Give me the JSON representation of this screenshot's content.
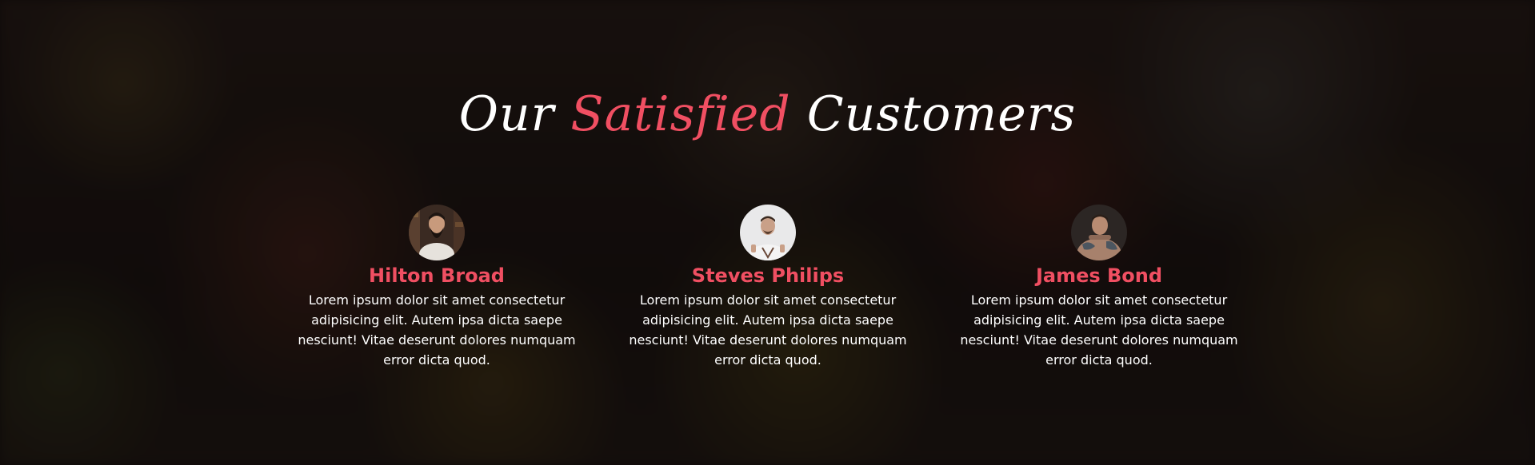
{
  "title": {
    "before": "Our",
    "accent": "Satisfied",
    "after": "Customers"
  },
  "customers": [
    {
      "name": "Hilton Broad",
      "text": "Lorem ipsum dolor sit amet consectetur adipisicing elit. Autem ipsa dicta saepe nesciunt! Vitae deserunt dolores numquam error dicta quod."
    },
    {
      "name": "Steves Philips",
      "text": "Lorem ipsum dolor sit amet consectetur adipisicing elit. Autem ipsa dicta saepe nesciunt! Vitae deserunt dolores numquam error dicta quod."
    },
    {
      "name": "James Bond",
      "text": "Lorem ipsum dolor sit amet consectetur adipisicing elit. Autem ipsa dicta saepe nesciunt! Vitae deserunt dolores numquam error dicta quod."
    }
  ],
  "colors": {
    "accent": "#f04f62",
    "text": "#ffffff",
    "overlay": "#0a0706"
  }
}
